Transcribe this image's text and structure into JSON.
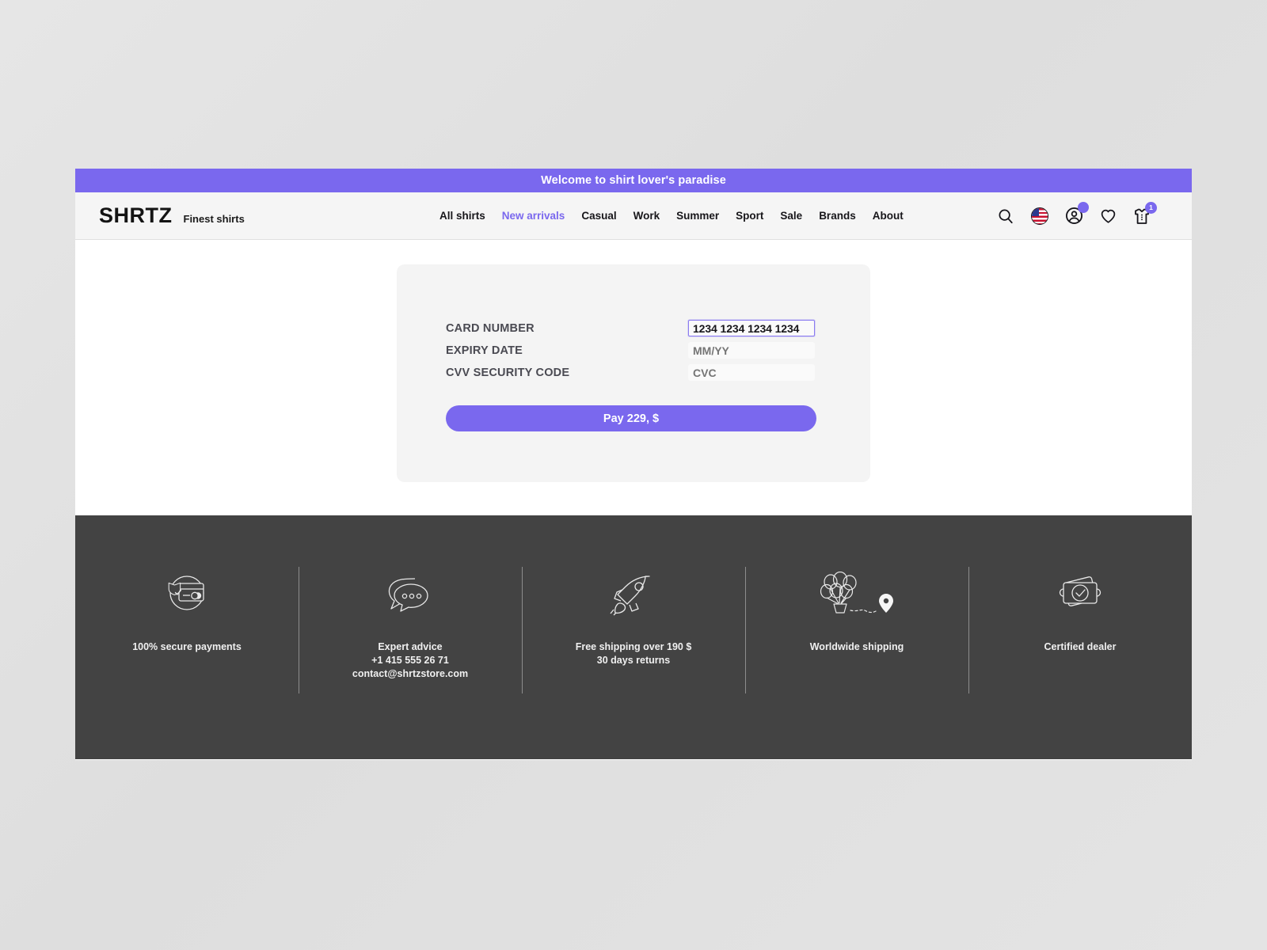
{
  "announcement": {
    "text": "Welcome to shirt lover's paradise"
  },
  "header": {
    "logo": "SHRTZ",
    "tagline": "Finest shirts",
    "nav": [
      {
        "label": "All shirts",
        "active": false
      },
      {
        "label": "New arrivals",
        "active": true
      },
      {
        "label": "Casual",
        "active": false
      },
      {
        "label": "Work",
        "active": false
      },
      {
        "label": "Summer",
        "active": false
      },
      {
        "label": "Sport",
        "active": false
      },
      {
        "label": "Sale",
        "active": false
      },
      {
        "label": "Brands",
        "active": false
      },
      {
        "label": "About",
        "active": false
      }
    ],
    "actions": {
      "search_icon": "search-icon",
      "language_icon": "us-flag-icon",
      "account_icon": "account-icon",
      "account_badge": "",
      "wishlist_icon": "heart-icon",
      "cart_icon": "shirt-cart-icon",
      "cart_badge": "1"
    }
  },
  "payment_form": {
    "rows": [
      {
        "label": "CARD NUMBER",
        "value": "1234 1234 1234 1234",
        "placeholder": "1234 1234 1234 1234",
        "focused": true
      },
      {
        "label": "EXPIRY DATE",
        "value": "",
        "placeholder": "MM/YY",
        "focused": false
      },
      {
        "label": "CVV SECURITY CODE",
        "value": "",
        "placeholder": "CVC",
        "focused": false
      }
    ],
    "pay_button_label": "Pay 229, $"
  },
  "footer": {
    "columns": [
      {
        "icon": "secure-payment-card-icon",
        "lines": [
          "100% secure payments"
        ]
      },
      {
        "icon": "chat-bubbles-icon",
        "lines": [
          "Expert advice",
          "+1 415 555 26 71",
          "contact@shrtzstore.com"
        ]
      },
      {
        "icon": "rocket-icon",
        "lines": [
          "Free shipping over 190 $",
          "30 days returns"
        ]
      },
      {
        "icon": "balloons-delivery-icon",
        "lines": [
          "Worldwide shipping"
        ]
      },
      {
        "icon": "certified-badge-icon",
        "lines": [
          "Certified dealer"
        ]
      }
    ]
  },
  "colors": {
    "accent": "#7a68ee",
    "footer_bg": "#434343",
    "card_bg": "#f4f4f4",
    "header_bg": "#f5f5f5"
  }
}
